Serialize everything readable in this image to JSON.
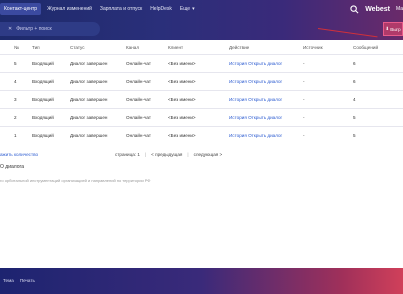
{
  "nav": {
    "items": [
      "Контакт-центр",
      "Журнал изменений",
      "Зарплата и отпуск",
      "HelpDesk",
      "Еще"
    ],
    "active_index": 0,
    "brand": "Webest",
    "brand_suffix": "Ма"
  },
  "filter": {
    "placeholder": "Фильтр + поиск",
    "clear_icon": "x-icon"
  },
  "export_button": {
    "label": "Выгр"
  },
  "table": {
    "headers": [
      "№",
      "Тип",
      "Статус",
      "Канал",
      "Клиент",
      "Действие",
      "Источник",
      "Сообщений"
    ],
    "rows": [
      {
        "num": "5",
        "type": "Входящий",
        "status": "Диалог завершен",
        "channel": "Онлайн-чат",
        "client": "<Без имени>",
        "action": "История Открыть диалог",
        "source": "-",
        "messages": "6"
      },
      {
        "num": "4",
        "type": "Входящий",
        "status": "Диалог завершен",
        "channel": "Онлайн-чат",
        "client": "<Без имени>",
        "action": "История Открыть диалог",
        "source": "-",
        "messages": "6"
      },
      {
        "num": "3",
        "type": "Входящий",
        "status": "Диалог завершен",
        "channel": "Онлайн-чат",
        "client": "<Без имени>",
        "action": "История Открыть диалог",
        "source": "-",
        "messages": "4"
      },
      {
        "num": "2",
        "type": "Входящий",
        "status": "Диалог завершен",
        "channel": "Онлайн-чат",
        "client": "<Без имени>",
        "action": "История Открыть диалог",
        "source": "-",
        "messages": "5"
      },
      {
        "num": "1",
        "type": "Входящий",
        "status": "Диалог завершен",
        "channel": "Онлайн-чат",
        "client": "<Без имени>",
        "action": "История Открыть диалог",
        "source": "-",
        "messages": "5"
      }
    ]
  },
  "pager": {
    "show_count": "ажить количество",
    "pages_label": "страница: 1",
    "prev": "< предыдущая",
    "next": "следующая >"
  },
  "section_title": "О диалога",
  "footnote": "го орбитальной инструментаций организацией и направлений по территории РФ",
  "footer": {
    "links": [
      "Тема",
      "Печать"
    ]
  },
  "colors": {
    "accent": "#2a5ad0",
    "export_bg": "#b03a6a",
    "header_bg": "#1d2a6b"
  }
}
